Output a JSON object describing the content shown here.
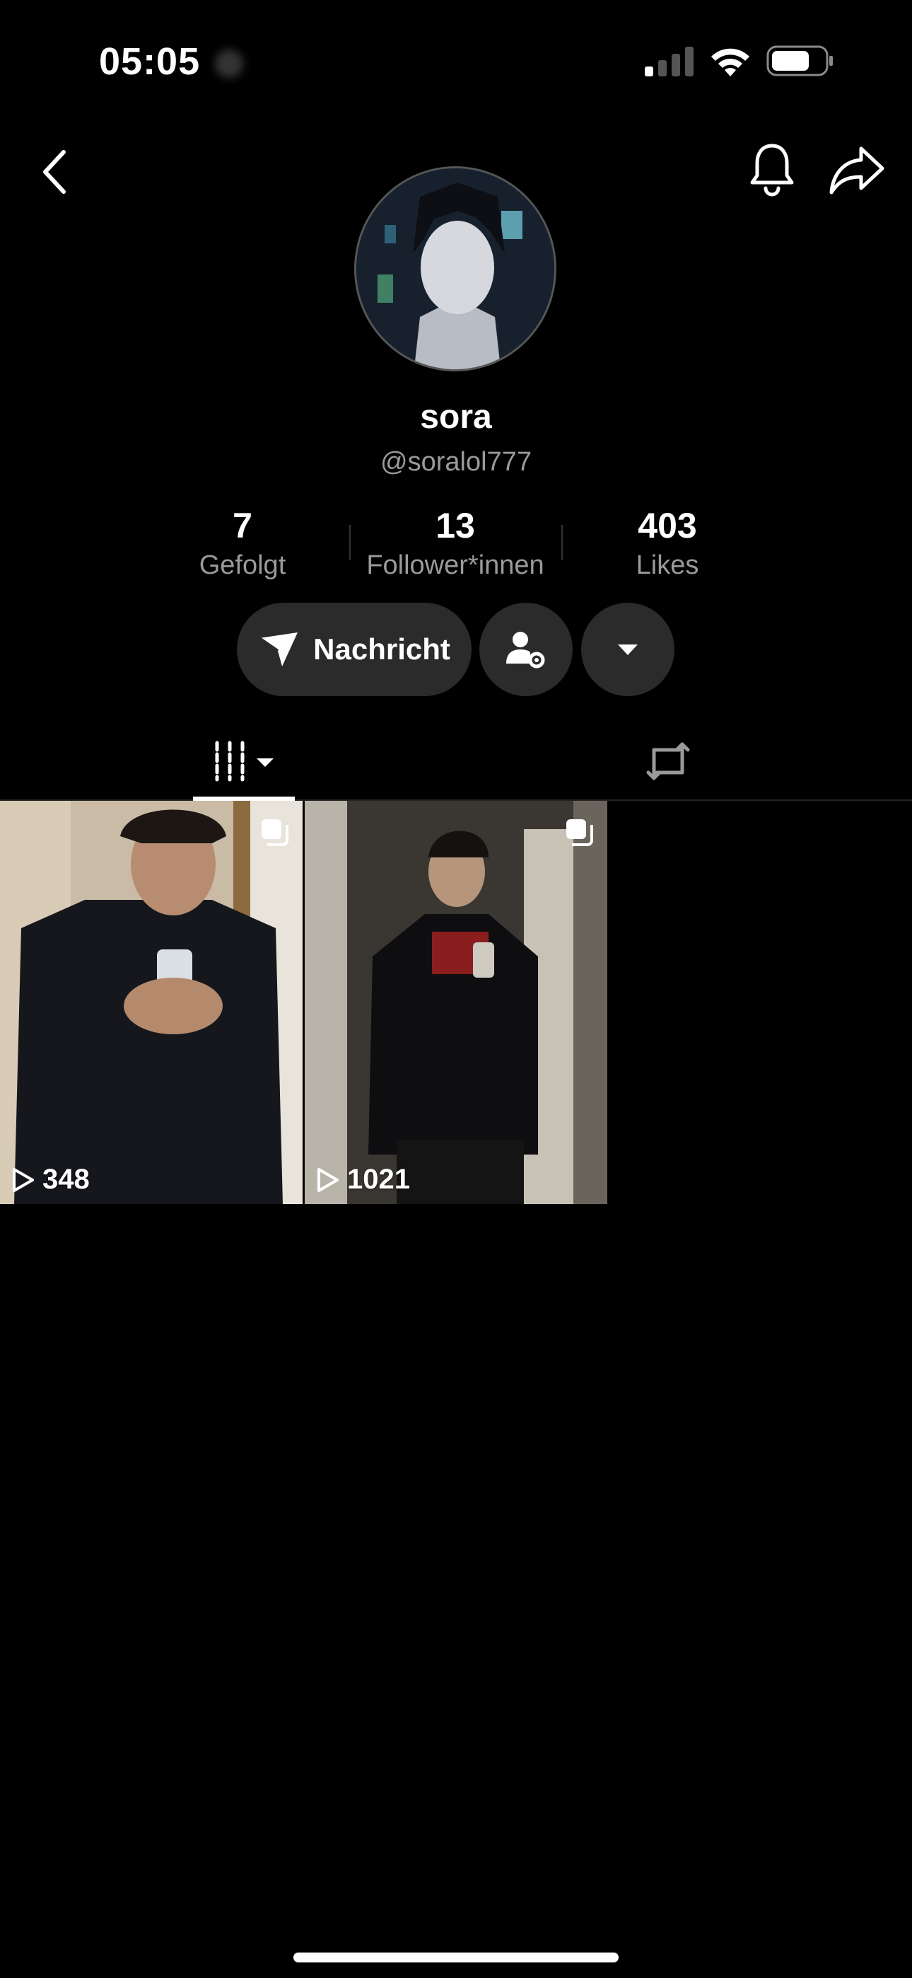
{
  "status_bar": {
    "time": "05:05",
    "icons": [
      "cellular-signal-icon",
      "wifi-icon",
      "battery-icon"
    ]
  },
  "header": {
    "icons": [
      "back-icon",
      "bell-icon",
      "share-icon"
    ]
  },
  "profile": {
    "display_name": "sora",
    "handle": "@soralol777"
  },
  "stats": [
    {
      "value": "7",
      "label": "Gefolgt"
    },
    {
      "value": "13",
      "label": "Follower*innen"
    },
    {
      "value": "403",
      "label": "Likes"
    }
  ],
  "actions": {
    "message_label": "Nachricht",
    "icons": [
      "send-icon",
      "user-settings-icon",
      "caret-down-icon"
    ]
  },
  "tabs": {
    "icons": [
      "videos-grid-icon",
      "repost-icon"
    ],
    "active": "videos"
  },
  "videos": [
    {
      "views": "348",
      "multi_icon": "multi-select-icon"
    },
    {
      "views": "1021",
      "multi_icon": "multi-select-icon"
    }
  ],
  "colors": {
    "background": "#000000",
    "button_bg": "#2b2b2b",
    "secondary_text": "#9a9a9a"
  }
}
